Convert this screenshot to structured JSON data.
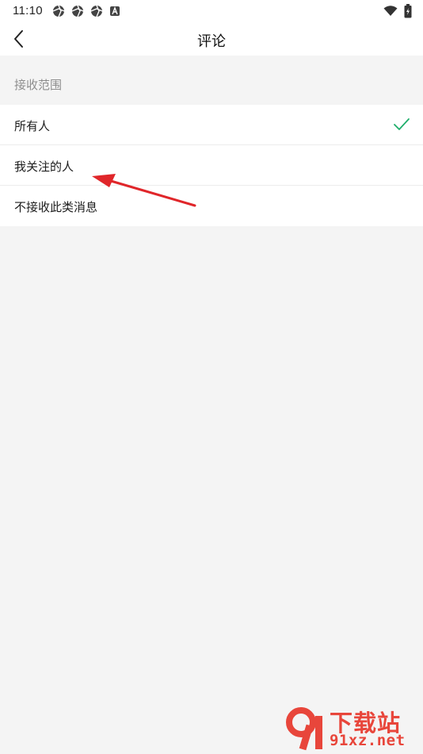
{
  "status_bar": {
    "time": "11:10",
    "left_icons": [
      "aperture-icon",
      "aperture-icon",
      "aperture-icon",
      "a-badge-icon"
    ],
    "right_icons": [
      "wifi-icon",
      "battery-charging-icon"
    ]
  },
  "header": {
    "title": "评论",
    "back_icon": "chevron-left-icon"
  },
  "section": {
    "label": "接收范围"
  },
  "options": [
    {
      "label": "所有人",
      "selected": true
    },
    {
      "label": "我关注的人",
      "selected": false
    },
    {
      "label": "不接收此类消息",
      "selected": false
    }
  ],
  "colors": {
    "accent": "#1fae6b",
    "arrow": "#e0262a",
    "watermark": "#e8463b"
  },
  "watermark": {
    "title": "下载站",
    "domain": "91xz.net"
  }
}
